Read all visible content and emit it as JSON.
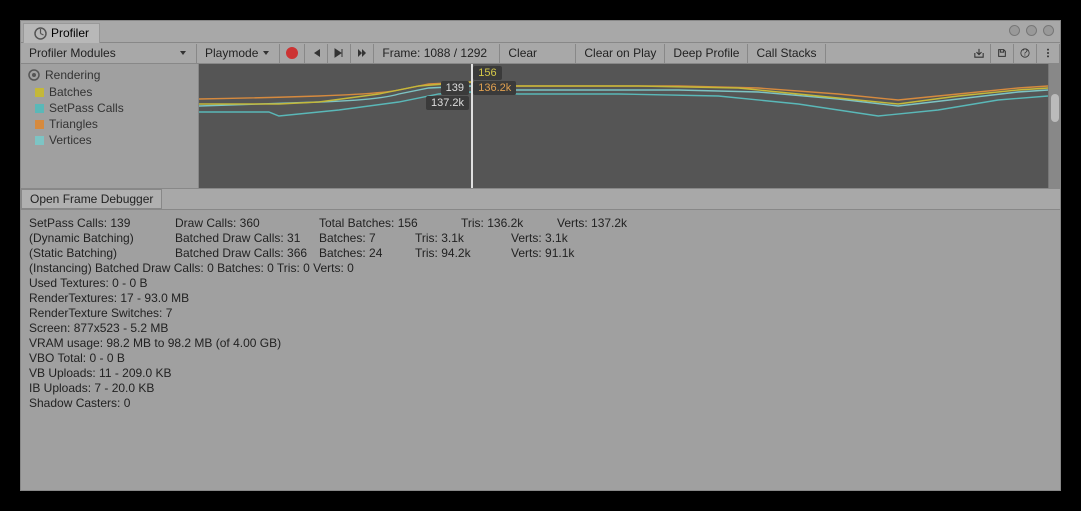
{
  "window": {
    "title": "Profiler"
  },
  "toolbar": {
    "modules_label": "Profiler Modules",
    "playmode_label": "Playmode",
    "frame_label": "Frame: 1088 / 1292",
    "clear": "Clear",
    "clear_on_play": "Clear on Play",
    "deep_profile": "Deep Profile",
    "call_stacks": "Call Stacks"
  },
  "sidebar": {
    "module": "Rendering",
    "items": [
      {
        "label": "Batches",
        "color": "#c4b83a"
      },
      {
        "label": "SetPass Calls",
        "color": "#5ab8b8"
      },
      {
        "label": "Triangles",
        "color": "#d68a3e"
      },
      {
        "label": "Vertices",
        "color": "#7dc4c4"
      }
    ]
  },
  "chart_data": {
    "type": "line",
    "cursor_labels": {
      "top": "156",
      "mid": "136.2k",
      "left_top": "139",
      "left_bot": "137.2k"
    }
  },
  "frame_debugger_btn": "Open Frame Debugger",
  "stats": {
    "r1": {
      "c1": "SetPass Calls: 139",
      "c2": "Draw Calls: 360",
      "c3": "Total Batches: 156",
      "c4": "Tris: 136.2k",
      "c5": "Verts: 137.2k"
    },
    "r2": {
      "c1": "(Dynamic Batching)",
      "c2": "Batched Draw Calls: 31",
      "c3": "Batches: 7",
      "c4": "Tris: 3.1k",
      "c5": "Verts: 3.1k"
    },
    "r3": {
      "c1": "(Static Batching)",
      "c2": "Batched Draw Calls: 366",
      "c3": "Batches: 24",
      "c4": "Tris: 94.2k",
      "c5": "Verts: 91.1k"
    },
    "r4": "(Instancing)       Batched Draw Calls: 0       Batches: 0          Tris: 0      Verts: 0",
    "lines": [
      "Used Textures: 0 - 0 B",
      "RenderTextures: 17 - 93.0 MB",
      "RenderTexture Switches: 7",
      "Screen: 877x523 - 5.2 MB",
      "VRAM usage: 98.2 MB to 98.2 MB (of 4.00 GB)",
      "VBO Total: 0 - 0 B",
      "VB Uploads: 11 - 209.0 KB",
      "IB Uploads: 7 - 20.0 KB",
      "Shadow Casters: 0"
    ]
  }
}
